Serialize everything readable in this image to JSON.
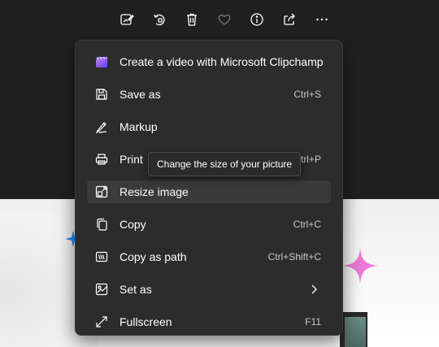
{
  "toolbar": {
    "buttons": [
      {
        "icon": "edit-image-icon"
      },
      {
        "icon": "rotate-icon"
      },
      {
        "icon": "delete-icon"
      },
      {
        "icon": "favorite-heart-icon"
      },
      {
        "icon": "info-icon"
      },
      {
        "icon": "share-icon"
      },
      {
        "icon": "more-options-icon"
      }
    ]
  },
  "menu": {
    "items": [
      {
        "label": "Create a video with Microsoft Clipchamp",
        "shortcut": "",
        "icon": "clipchamp-icon"
      },
      {
        "label": "Save as",
        "shortcut": "Ctrl+S",
        "icon": "save-icon"
      },
      {
        "label": "Markup",
        "shortcut": "",
        "icon": "markup-pen-icon"
      },
      {
        "label": "Print",
        "shortcut": "Ctrl+P",
        "icon": "print-icon"
      },
      {
        "label": "Resize image",
        "shortcut": "",
        "icon": "resize-image-icon"
      },
      {
        "label": "Copy",
        "shortcut": "Ctrl+C",
        "icon": "copy-icon"
      },
      {
        "label": "Copy as path",
        "shortcut": "Ctrl+Shift+C",
        "icon": "copy-path-icon"
      },
      {
        "label": "Set as",
        "shortcut": "",
        "icon": "set-as-icon",
        "has_submenu": true
      },
      {
        "label": "Fullscreen",
        "shortcut": "F11",
        "icon": "fullscreen-icon"
      }
    ],
    "hovered_item": "Resize image"
  },
  "tooltip": {
    "text": "Change the size of your picture"
  },
  "colors": {
    "menu_bg": "#2c2c2c",
    "hover_bg": "#3a3a3a",
    "text": "#ffffff",
    "shortcut": "#c8c8c8",
    "accent_pink": "#f07ad8",
    "accent_blue": "#1e90ff"
  }
}
